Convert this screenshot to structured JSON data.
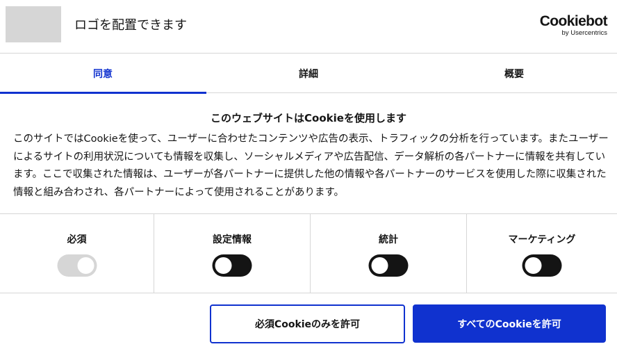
{
  "header": {
    "logo_text": "ロゴを配置できます",
    "brand_name": "Cookiebot",
    "brand_sub": "by Usercentrics"
  },
  "tabs": [
    {
      "label": "同意",
      "active": true
    },
    {
      "label": "詳細",
      "active": false
    },
    {
      "label": "概要",
      "active": false
    }
  ],
  "content": {
    "title": "このウェブサイトはCookieを使用します",
    "text": "このサイトではCookieを使って、ユーザーに合わせたコンテンツや広告の表示、トラフィックの分析を行っています。またユーザーによるサイトの利用状況についても情報を収集し、ソーシャルメディアや広告配信、データ解析の各パートナーに情報を共有しています。ここで収集された情報は、ユーザーが各パートナーに提供した他の情報や各パートナーのサービスを使用した際に収集された情報と組み合わされ、各パートナーによって使用されることがあります。"
  },
  "categories": [
    {
      "label": "必須",
      "enabled": true,
      "locked": true
    },
    {
      "label": "設定情報",
      "enabled": false,
      "locked": false
    },
    {
      "label": "統計",
      "enabled": false,
      "locked": false
    },
    {
      "label": "マーケティング",
      "enabled": false,
      "locked": false
    }
  ],
  "buttons": {
    "necessary_only": "必須Cookieのみを許可",
    "allow_all": "すべてのCookieを許可"
  },
  "colors": {
    "accent": "#1032cf",
    "toggle_off": "#141414",
    "toggle_disabled": "#d6d6d6",
    "divider": "#d6d6d6"
  }
}
